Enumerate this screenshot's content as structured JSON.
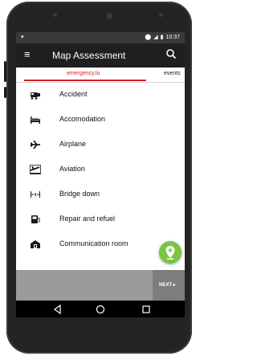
{
  "status": {
    "time": "10:37"
  },
  "appbar": {
    "title": "Map Assessment",
    "menu_icon": "hamburger-menu-icon",
    "search_icon": "search-icon"
  },
  "tabs": [
    {
      "label": "emergency.lu",
      "active": true
    },
    {
      "label": "events",
      "active": false
    }
  ],
  "list": {
    "items": [
      {
        "label": "Accident",
        "icon": "accident-icon"
      },
      {
        "label": "Accomodation",
        "icon": "bed-icon"
      },
      {
        "label": "Airplane",
        "icon": "airplane-icon"
      },
      {
        "label": "Aviation",
        "icon": "airplane-takeoff-icon"
      },
      {
        "label": "Bridge down",
        "icon": "bridge-icon"
      },
      {
        "label": "Repair and refuel",
        "icon": "fuel-pump-icon"
      },
      {
        "label": "Communication room",
        "icon": "communication-room-icon"
      }
    ]
  },
  "fab": {
    "icon": "add-location-icon",
    "color": "#7cc443"
  },
  "bottom": {
    "next_label": "NEXT ▸"
  },
  "colors": {
    "accent": "#d81f26",
    "appbar": "#1f1f1f"
  }
}
